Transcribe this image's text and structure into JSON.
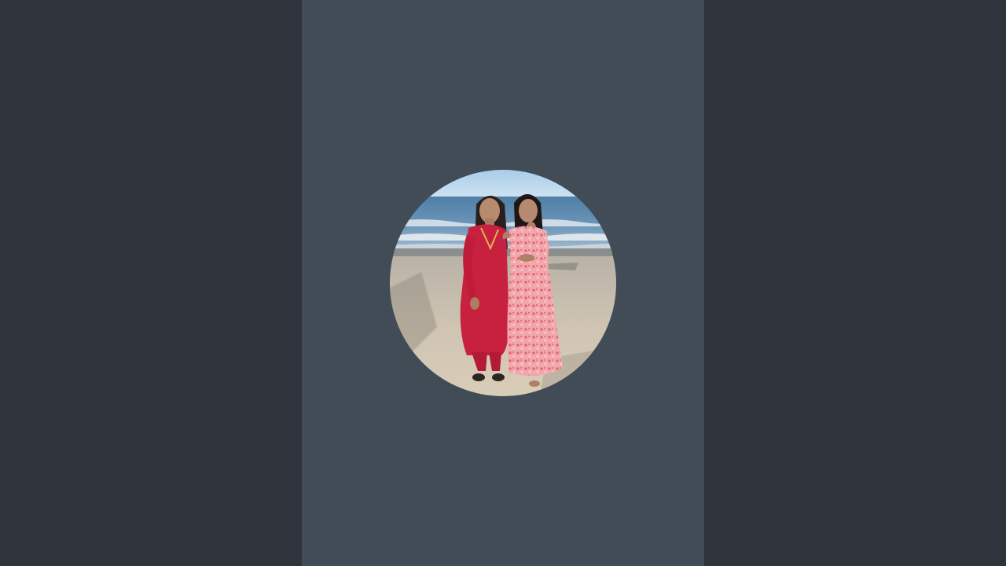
{
  "screen": {
    "background_color": "#2e333c",
    "panel_color": "#414c56"
  },
  "avatar": {
    "shape": "circle",
    "depicts": "photo"
  }
}
